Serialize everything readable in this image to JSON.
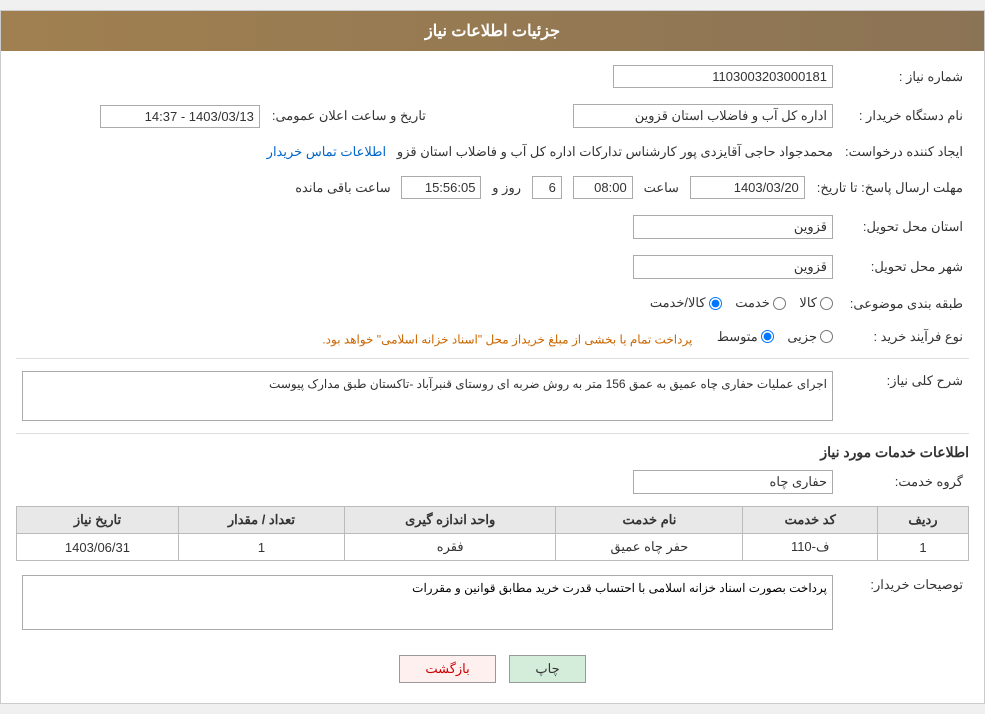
{
  "header": {
    "title": "جزئیات اطلاعات نیاز"
  },
  "fields": {
    "need_number_label": "شماره نیاز :",
    "need_number_value": "1103003203000181",
    "buyer_org_label": "نام دستگاه خریدار :",
    "buyer_org_value": "اداره کل آب و فاضلاب استان قزوین",
    "creator_label": "ایجاد کننده درخواست:",
    "creator_value": "محمدجواد حاجی آقایزدی پور کارشناس تدارکات اداره کل آب و فاضلاب استان قزو",
    "creator_link": "اطلاعات تماس خریدار",
    "deadline_label": "مهلت ارسال پاسخ: تا تاریخ:",
    "announce_datetime_label": "تاریخ و ساعت اعلان عمومی:",
    "announce_datetime_value": "1403/03/13 - 14:37",
    "date_value": "1403/03/20",
    "time_value": "08:00",
    "days_value": "6",
    "remaining_value": "15:56:05",
    "province_label": "استان محل تحویل:",
    "province_value": "قزوین",
    "city_label": "شهر محل تحویل:",
    "city_value": "قزوین",
    "category_label": "طبقه بندی موضوعی:",
    "category_kala": "کالا",
    "category_khedmat": "خدمت",
    "category_kala_khedmat": "کالا/خدمت",
    "purchase_type_label": "نوع فرآیند خرید :",
    "purchase_jozyi": "جزیی",
    "purchase_motawaset": "متوسط",
    "purchase_note": "پرداخت تمام یا بخشی از مبلغ خریداز محل \"اسناد خزانه اسلامی\" خواهد بود.",
    "need_description_label": "شرح کلی نیاز:",
    "need_description_value": "اجرای عملیات حفاری چاه عمیق به عمق 156 متر  به روش ضربه ای روستای قنبرآباد -تاکستان طبق مدارک پیوست",
    "services_info_label": "اطلاعات خدمات مورد نیاز",
    "service_group_label": "گروه خدمت:",
    "service_group_value": "حفاری چاه",
    "table": {
      "col_row": "ردیف",
      "col_code": "کد خدمت",
      "col_name": "نام خدمت",
      "col_unit": "واحد اندازه گیری",
      "col_count": "تعداد / مقدار",
      "col_date": "تاریخ نیاز",
      "rows": [
        {
          "row": "1",
          "code": "ف-110",
          "name": "حفر چاه عمیق",
          "unit": "فقره",
          "count": "1",
          "date": "1403/06/31"
        }
      ]
    },
    "buyer_notes_label": "توصیحات خریدار:",
    "buyer_notes_value": "پرداخت بصورت اسناد خزانه اسلامی با احتساب قدرت خرید مطابق قوانین و مقررات"
  },
  "buttons": {
    "print_label": "چاپ",
    "back_label": "بازگشت"
  }
}
